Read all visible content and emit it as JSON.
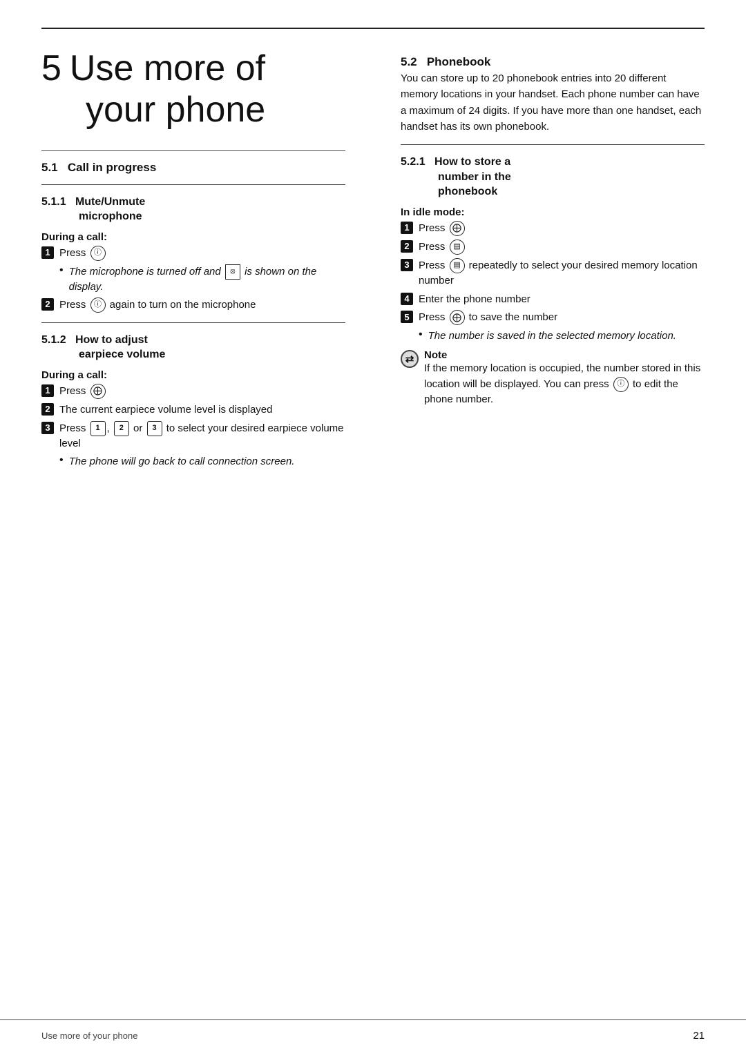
{
  "chapter": {
    "number": "5",
    "title_line1": "Use more of",
    "title_line2": "your phone"
  },
  "section51": {
    "label": "5.1",
    "title": "Call in progress"
  },
  "section511": {
    "label": "5.1.1",
    "title_line1": "Mute/Unmute",
    "title_line2": "microphone"
  },
  "during_a_call_1": "During a call:",
  "steps_511": [
    {
      "num": "1",
      "text_before": "Press",
      "icon": "mic_icon",
      "text_after": ""
    },
    {
      "bullet": true,
      "text": "The microphone is turned off and  ⊠  is shown on the display."
    },
    {
      "num": "2",
      "text_before": "Press",
      "icon": "mic_icon",
      "text_after": " again to turn on the microphone"
    }
  ],
  "section512": {
    "label": "5.1.2",
    "title_line1": "How to adjust",
    "title_line2": "earpiece volume"
  },
  "during_a_call_2": "During a call:",
  "steps_512": [
    {
      "num": "1",
      "text_before": "Press",
      "icon": "nav_icon",
      "text_after": ""
    },
    {
      "num": "2",
      "text_before": "",
      "text_after": "The current earpiece volume level is displayed"
    },
    {
      "num": "3",
      "text_before": "Press",
      "icons": [
        "1_icon",
        "2_icon",
        "3_icon"
      ],
      "text_after": " to select your desired earpiece volume level"
    },
    {
      "bullet": true,
      "text": "The phone will go back to call connection screen."
    }
  ],
  "section52": {
    "label": "5.2",
    "title": "Phonebook"
  },
  "phonebook_body": "You can store up to 20 phonebook entries into 20 different memory locations in your handset. Each phone number can have a maximum of 24 digits. If you have more than one handset, each handset has its own phonebook.",
  "section521": {
    "label": "5.2.1",
    "title_line1": "How to store a",
    "title_line2": "number in the",
    "title_line3": "phonebook"
  },
  "in_idle_mode": "In idle mode:",
  "steps_521": [
    {
      "num": "1",
      "text_before": "Press",
      "icon": "nav_icon",
      "text_after": ""
    },
    {
      "num": "2",
      "text_before": "Press",
      "icon": "menu_icon",
      "text_after": ""
    },
    {
      "num": "3",
      "text_before": "Press",
      "icon": "menu_icon",
      "text_after": " repeatedly to select your desired memory location number"
    },
    {
      "num": "4",
      "text_before": "",
      "text_after": "Enter the phone number"
    },
    {
      "num": "5",
      "text_before": "Press",
      "icon": "nav_icon",
      "text_after": " to save the number"
    },
    {
      "bullet": true,
      "text": "The number is saved in the selected memory location."
    }
  ],
  "note_label": "Note",
  "note_text": "If the memory location is occupied, the number stored in this location will be displayed. You can press  Ⓒ  to edit the phone number.",
  "footer": {
    "left": "Use more of your phone",
    "right": "21"
  }
}
